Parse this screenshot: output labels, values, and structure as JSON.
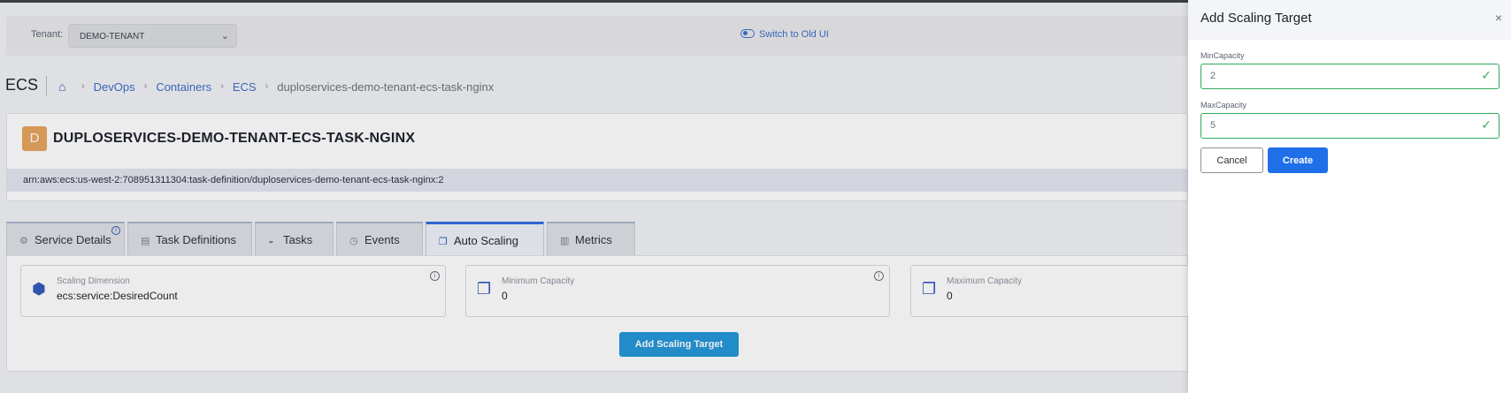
{
  "header": {
    "tenant_label": "Tenant:",
    "tenant_value": "DEMO-TENANT",
    "switch_ui_label": "Switch to Old UI"
  },
  "breadcrumb": {
    "page_title": "ECS",
    "items": [
      "DevOps",
      "Containers",
      "ECS"
    ],
    "current": "duploservices-demo-tenant-ecs-task-nginx"
  },
  "service": {
    "avatar_letter": "D",
    "title": "DUPLOSERVICES-DEMO-TENANT-ECS-TASK-NGINX",
    "arn": "arn:aws:ecs:us-west-2:708951311304:task-definition/duploservices-demo-tenant-ecs-task-nginx:2"
  },
  "tabs": [
    {
      "label": "Service Details",
      "icon": "gears-icon"
    },
    {
      "label": "Task Definitions",
      "icon": "task-definitions-icon"
    },
    {
      "label": "Tasks",
      "icon": "docker-icon"
    },
    {
      "label": "Events",
      "icon": "clock-icon"
    },
    {
      "label": "Auto Scaling",
      "icon": "copy-icon",
      "active": true
    },
    {
      "label": "Metrics",
      "icon": "bar-chart-icon"
    }
  ],
  "stats": [
    {
      "label": "Scaling Dimension",
      "value": "ecs:service:DesiredCount",
      "icon": "cube-icon"
    },
    {
      "label": "Minimum Capacity",
      "value": "0",
      "icon": "copy-icon"
    },
    {
      "label": "Maximum Capacity",
      "value": "0",
      "icon": "copy-icon"
    }
  ],
  "add_scaling_target_button": "Add Scaling Target",
  "drawer": {
    "title": "Add Scaling Target",
    "close": "×",
    "min_label": "MinCapacity",
    "min_value": "2",
    "max_label": "MaxCapacity",
    "max_value": "5",
    "cancel_label": "Cancel",
    "create_label": "Create"
  },
  "colors": {
    "accent": "#1f6fe8",
    "valid_border": "#2faa59",
    "avatar": "#e7a35b",
    "add_button": "#2196d8"
  }
}
